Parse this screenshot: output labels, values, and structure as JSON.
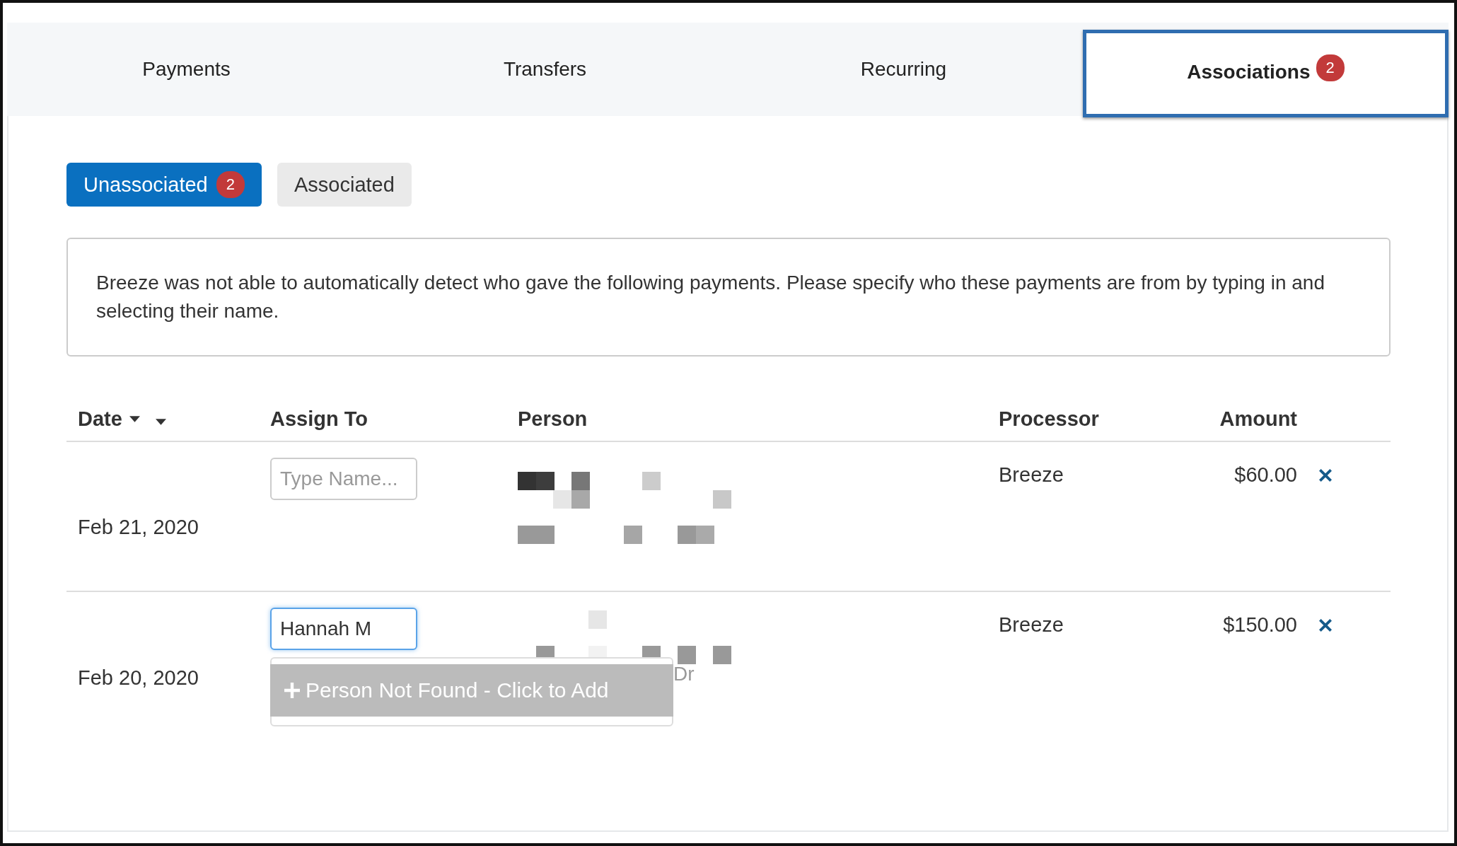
{
  "tabs": [
    {
      "label": "Payments",
      "selected": false
    },
    {
      "label": "Transfers",
      "selected": false
    },
    {
      "label": "Recurring",
      "selected": false
    },
    {
      "label": "Associations",
      "selected": true,
      "badge": "2"
    }
  ],
  "filters": [
    {
      "label": "Unassociated",
      "selected": true,
      "badge": "2"
    },
    {
      "label": "Associated",
      "selected": false
    }
  ],
  "notice": "Breeze was not able to automatically detect who gave the following payments. Please specify who these payments are from by typing in and selecting their name.",
  "table": {
    "columns": [
      "Date",
      "Assign To",
      "Person",
      "Processor",
      "Amount"
    ],
    "rows": [
      {
        "date": "Feb 21, 2020",
        "assign_to": {
          "placeholder": "Type Name...",
          "focused": false
        },
        "processor": "Breeze",
        "amount": "$60.00"
      },
      {
        "date": "Feb 20, 2020",
        "assign_to": {
          "value": "Hannah M",
          "focused": true
        },
        "person_fragment": "Dr",
        "dropdown": {
          "label": "Person Not Found - Click to Add"
        },
        "processor": "Breeze",
        "amount": "$150.00"
      }
    ]
  }
}
